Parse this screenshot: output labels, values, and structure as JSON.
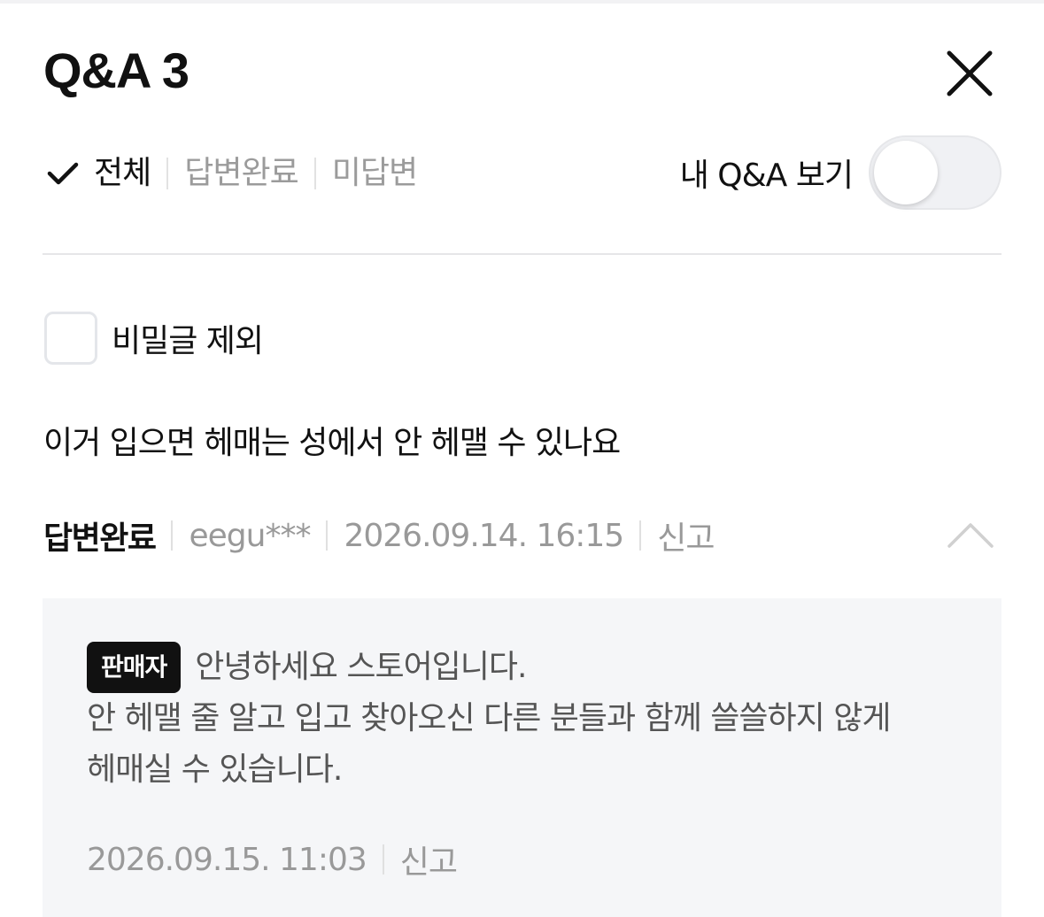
{
  "header": {
    "title": "Q&A 3",
    "close_icon": "close-icon"
  },
  "filters": {
    "options": [
      {
        "label": "전체",
        "active": true
      },
      {
        "label": "답변완료",
        "active": false
      },
      {
        "label": "미답변",
        "active": false
      }
    ],
    "my_qa_label": "내 Q&A 보기",
    "my_qa_toggle_on": false
  },
  "secret_filter": {
    "label": "비밀글 제외",
    "checked": false
  },
  "qa_item": {
    "question": "이거 입으면 헤매는 성에서 안 헤맬 수 있나요",
    "status": "답변완료",
    "author": "eegu***",
    "date": "2026.09.14. 16:15",
    "report_label": "신고",
    "expanded": true,
    "answer": {
      "badge": "판매자",
      "lines": [
        "안녕하세요 스토어입니다.",
        "안 헤맬 줄 알고 입고 찾아오신 다른 분들과 함께 쓸쓸하지 않게",
        "헤매실 수 있습니다."
      ],
      "date": "2026.09.15. 11:03",
      "report_label": "신고"
    }
  },
  "colors": {
    "text_primary": "#111111",
    "text_muted": "#999999",
    "answer_bg": "#f5f6f8",
    "badge_bg": "#111111"
  }
}
